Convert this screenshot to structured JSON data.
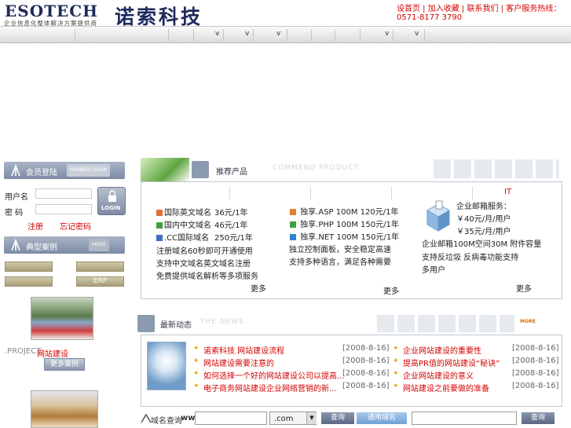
{
  "header": {
    "logo_en": "ESOTECH",
    "logo_sub": "企业信息化整体解决方案提供商",
    "logo_cn": "诺索科技",
    "links": [
      "设首页",
      "加入收藏",
      "联系我们"
    ],
    "phone_label": "客户服务热线：",
    "phone": "0571-8177 3790"
  },
  "nav": {
    "arrow": "v"
  },
  "member": {
    "title": "会员登陆",
    "title_en": "MEMBER LOGIN",
    "user_label": "用户名",
    "pass_label": "密 码",
    "login_btn": "LOGIN",
    "register": "注册",
    "forgot": "忘记密码"
  },
  "cases": {
    "title": "典型案例",
    "more": "MORE",
    "erp": "ERP",
    "project_label": ".PROJECT:",
    "project_value": "网站建设",
    "more_btn": "更多案例"
  },
  "products": {
    "title": "推荐产品",
    "title_en": "COMMEND PRODUCT",
    "it_label": "IT",
    "col1": [
      {
        "name": "国际英文域名",
        "price": "36元/1年"
      },
      {
        "name": "国内中文域名",
        "price": "46元/1年"
      },
      {
        "name": ".CC国际域名",
        "price": "250元/1年"
      }
    ],
    "col1_text": [
      "注册域名60秒即可开通使用",
      "支持中文域名英文域名注册",
      "免费提供域名解析等多项服务"
    ],
    "col1_more": "更多",
    "col2": [
      {
        "name": "独享.ASP 100M",
        "price": "120元/1年"
      },
      {
        "name": "独享.PHP 100M",
        "price": "150元/1年"
      },
      {
        "name": "独享.NET 100M",
        "price": "150元/1年"
      }
    ],
    "col2_text": [
      "独立控制面板，安全稳定高速",
      "支持多种语言，满足各种需要"
    ],
    "col2_more": "更多",
    "col3": [
      "企业邮箱服务：",
      "￥40元/月/用户",
      "￥35元/月/用户"
    ],
    "col3_text": [
      "企业邮箱100M空间30M 附件容量",
      "支持反垃圾 反病毒功能支持",
      "多用户"
    ],
    "col3_more": "更多"
  },
  "news": {
    "title": "最新动态",
    "title_en": "THE NEWS",
    "more": "MORE",
    "left": [
      {
        "title": "诺索科技 网站建设流程",
        "date": "[2008-8-16]"
      },
      {
        "title": "网站建设需要注意的",
        "date": "[2008-8-16]"
      },
      {
        "title": "如何选择一个好的网站建设公司以提高...",
        "date": "[2008-8-16]"
      },
      {
        "title": "电子商务网站建设企业网络营销的新...",
        "date": "[2008-8-16]"
      }
    ],
    "right": [
      {
        "title": "企业网站建设的重要性",
        "date": "[2008-8-16]"
      },
      {
        "title": "提高PR值的网站建设“秘诀”",
        "date": "[2008-8-16]"
      },
      {
        "title": "企业网站建设的意义",
        "date": "[2008-8-16]"
      },
      {
        "title": "网站建设之前要做的准备",
        "date": "[2008-8-16]"
      }
    ]
  },
  "domain": {
    "label": "域名查询",
    "prefix": "www.",
    "tld": ".com",
    "search_btn": "查询",
    "general_btn": "通用域名",
    "search_btn2": "查询"
  }
}
